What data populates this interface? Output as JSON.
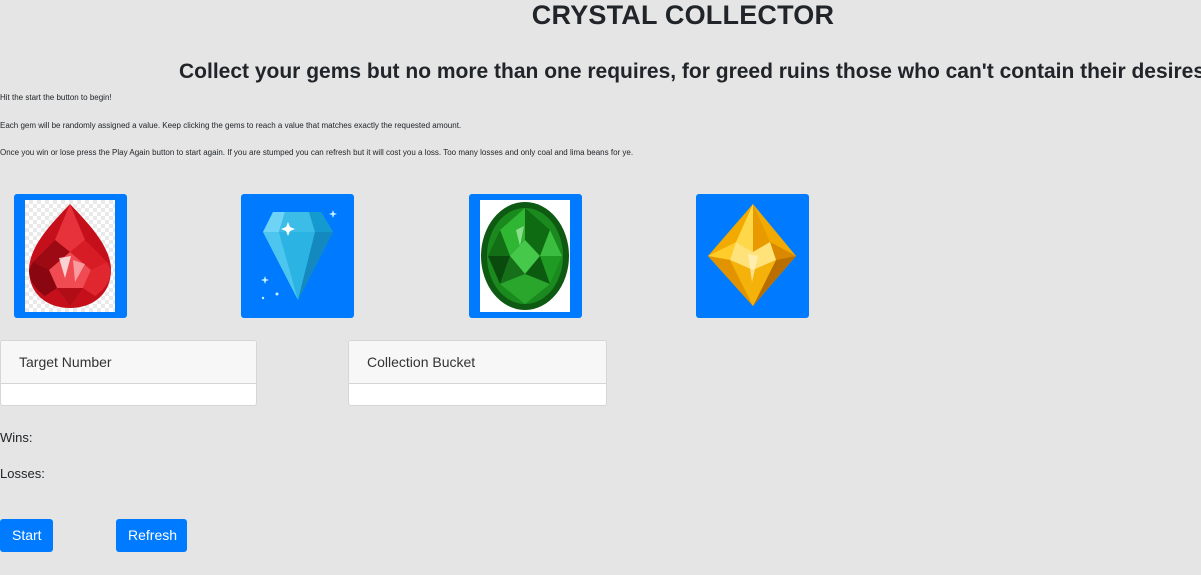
{
  "header": {
    "title": "CRYSTAL COLLECTOR",
    "subtitle": "Collect your gems but no more than one requires, for greed ruins those who can't contain their desires!"
  },
  "instructions": [
    "Hit the start the button to begin!",
    "Each gem will be randomly assigned a value. Keep clicking the gems to reach a value that matches exactly the requested amount.",
    "Once you win or lose press the Play Again button to start again. If you are stumped you can refresh but it will cost you a loss. Too many losses and only coal and lima beans for ye."
  ],
  "gems": [
    {
      "name": "red-ruby-gem",
      "icon": "ruby-icon",
      "color": "#d7141f"
    },
    {
      "name": "blue-diamond-gem",
      "icon": "diamond-icon",
      "color": "#1fa5d8"
    },
    {
      "name": "green-emerald-gem",
      "icon": "emerald-icon",
      "color": "#1d8a1f"
    },
    {
      "name": "yellow-topaz-gem",
      "icon": "topaz-icon",
      "color": "#f2a900"
    }
  ],
  "target": {
    "label": "Target Number",
    "value": ""
  },
  "bucket": {
    "label": "Collection Bucket",
    "value": ""
  },
  "stats": {
    "wins_label": "Wins:",
    "wins_value": "",
    "losses_label": "Losses:",
    "losses_value": ""
  },
  "buttons": {
    "start": "Start",
    "refresh": "Refresh"
  },
  "colors": {
    "background": "#e5e5e5",
    "accent": "#007bff"
  }
}
